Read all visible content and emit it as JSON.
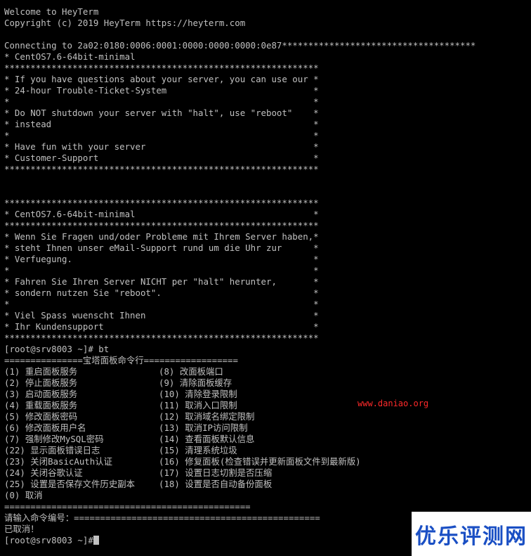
{
  "terminal": {
    "header_lines": [
      "Welcome to HeyTerm",
      "Copyright (c) 2019 HeyTerm https://heyterm.com",
      "",
      "Connecting to 2a02:0180:0006:0001:0000:0000:0000:0e87*************************************",
      "* CentOS7.6-64bit-minimal",
      "************************************************************",
      "* If you have questions about your server, you can use our *",
      "* 24-hour Trouble-Ticket-System                            *",
      "*                                                          *",
      "* Do NOT shutdown your server with \"halt\", use \"reboot\"    *",
      "* instead                                                  *",
      "*                                                          *",
      "* Have fun with your server                                *",
      "* Customer-Support                                         *",
      "************************************************************",
      "",
      "",
      "************************************************************",
      "* CentOS7.6-64bit-minimal                                  *",
      "************************************************************",
      "* Wenn Sie Fragen und/oder Probleme mit Ihrem Server haben,*",
      "* steht Ihnen unser eMail-Support rund um die Uhr zur      *",
      "* Verfuegung.                                              *",
      "*                                                          *",
      "* Fahren Sie Ihren Server NICHT per \"halt\" herunter,       *",
      "* sondern nutzen Sie \"reboot\".                             *",
      "*                                                          *",
      "* Viel Spass wuenscht Ihnen                                *",
      "* Ihr Kundensupport                                        *",
      "************************************************************",
      "[root@srv8003 ~]# bt",
      ""
    ],
    "menu_title": "===============宝塔面板命令行==================",
    "menu_rows": [
      [
        "(1) 重启面板服务",
        "(8) 改面板端口"
      ],
      [
        "(2) 停止面板服务",
        "(9) 清除面板缓存"
      ],
      [
        "(3) 启动面板服务",
        "(10) 清除登录限制"
      ],
      [
        "(4) 重载面板服务",
        "(11) 取消入口限制"
      ],
      [
        "(5) 修改面板密码",
        "(12) 取消域名绑定限制"
      ],
      [
        "(6) 修改面板用户名",
        "(13) 取消IP访问限制"
      ],
      [
        "(7) 强制修改MySQL密码",
        "(14) 查看面板默认信息"
      ],
      [
        "(22) 显示面板错误日志",
        "(15) 清理系统垃圾"
      ],
      [
        "(23) 关闭BasicAuth认证",
        "(16) 修复面板(检查错误并更新面板文件到最新版)"
      ],
      [
        "(24) 关闭谷歌认证",
        "(17) 设置日志切割是否压缩"
      ],
      [
        "(25) 设置是否保存文件历史副本",
        "(18) 设置是否自动备份面板"
      ],
      [
        "(0) 取消",
        ""
      ]
    ],
    "menu_footer": "===============================================",
    "input_prompt": "请输入命令编号：===============================================",
    "cancelled": "已取消！",
    "final_prompt": "[root@srv8003 ~]#"
  },
  "watermark": {
    "url": "www.daniao.org",
    "brand": "优乐评测网"
  },
  "colors": {
    "background": "#000000",
    "text": "#c0c0c0",
    "watermark_url": "#ff2a2a",
    "brand_text": "#1a4fc4"
  }
}
